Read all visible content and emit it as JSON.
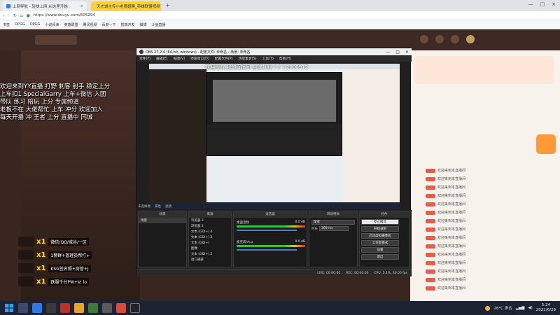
{
  "browser": {
    "tabs": [
      {
        "label": "上网导航 - 轻快上网 从这里开始"
      },
      {
        "label": "天才城主传小老婆翅膀_英雄联盟视频"
      }
    ],
    "url": "https://www.douyu.com/605294",
    "bookmarks": [
      "书签",
      "OPGG",
      "OPGG",
      "小说阅读",
      "英雄联盟",
      "腾讯视频",
      "百度一下",
      "前端开发",
      "微博",
      "斗鱼直播"
    ]
  },
  "obs": {
    "title": "OBS 27.2.4 (64-bit, windows) - 配置文件: 未命名 - 场景: 未命名",
    "menu": [
      "文件(F)",
      "编辑(E)",
      "视图(V)",
      "停靠窗口(D)",
      "配置文件(P)",
      "场景集合(S)",
      "工具(T)",
      "帮助(H)"
    ],
    "preview_banner": "欢迎观看 我的直播间 自律打野 Y丫丫2000912",
    "no_source": "未选择源",
    "toolbar_buttons": [
      "属性",
      "滤镜"
    ],
    "docks": {
      "scenes": {
        "title": "场景",
        "items": [
          "场景"
        ]
      },
      "sources": {
        "title": "来源",
        "items": [
          "浏览器 3",
          "浏览器 2",
          "文本 (GDI+) 4",
          "文本 (GDI+) 3",
          "文本 (GDI+)",
          "图像",
          "文本 (GDI+) 2",
          "窗口捕获"
        ]
      },
      "mixer": {
        "title": "混音器",
        "channels": [
          {
            "name": "桌面音频",
            "db": "0.0 dB"
          },
          {
            "name": "麦克风/Aux",
            "db": "0.0 dB"
          }
        ]
      },
      "transitions": {
        "title": "转场特效",
        "type": "渐变",
        "duration_label": "时长",
        "duration": "300 ms"
      },
      "controls": {
        "title": "控件",
        "buttons": [
          "停止推流",
          "开始录制",
          "启动虚拟摄像机",
          "工作室模式",
          "设置",
          "退出"
        ]
      }
    },
    "status": [
      "LIVE: 00:00:00",
      "REC: 00:00:00",
      "CPU: 5.4%, 60.00 fps"
    ]
  },
  "stream_overlay": {
    "lines": [
      "欢迎来到YY直播 打野 刺客 射手 稳定上分",
      "上车扣1 SpecialGarry 上车+微信 入团",
      "带队 练习 陪玩 上分 专属频道",
      "老板不在 大佬帮忙 上车 冲分 欢迎加入",
      "每天开播 冲 王者 上分 直播中 同城"
    ],
    "gifts": [
      {
        "mult": "x1",
        "desc": "微信/QQ/城谷/一区"
      },
      {
        "mult": "x1",
        "desc": "1警群+管理员帮打+"
      },
      {
        "mult": "x1",
        "desc": "KSG签名照+房管+J"
      },
      {
        "mult": "x1",
        "desc": "跃服千分PW+V: lo"
      }
    ]
  },
  "chat": {
    "rows": [
      "欢迎来到本直播间",
      "欢迎来到本直播间",
      "欢迎来到本直播间",
      "欢迎来到本直播间",
      "欢迎来到本直播间",
      "欢迎来到本直播间",
      "欢迎来到本直播间",
      "欢迎来到本直播间",
      "欢迎来到本直播间",
      "欢迎来到本直播间",
      "欢迎来到本直播间",
      "欢迎来到本直播间",
      "欢迎来到本直播间",
      "欢迎来到本直播间",
      "欢迎来到本直播间"
    ]
  },
  "taskbar": {
    "weather": "28°C 多云",
    "time": "5:24",
    "date": "2022/6/28"
  }
}
